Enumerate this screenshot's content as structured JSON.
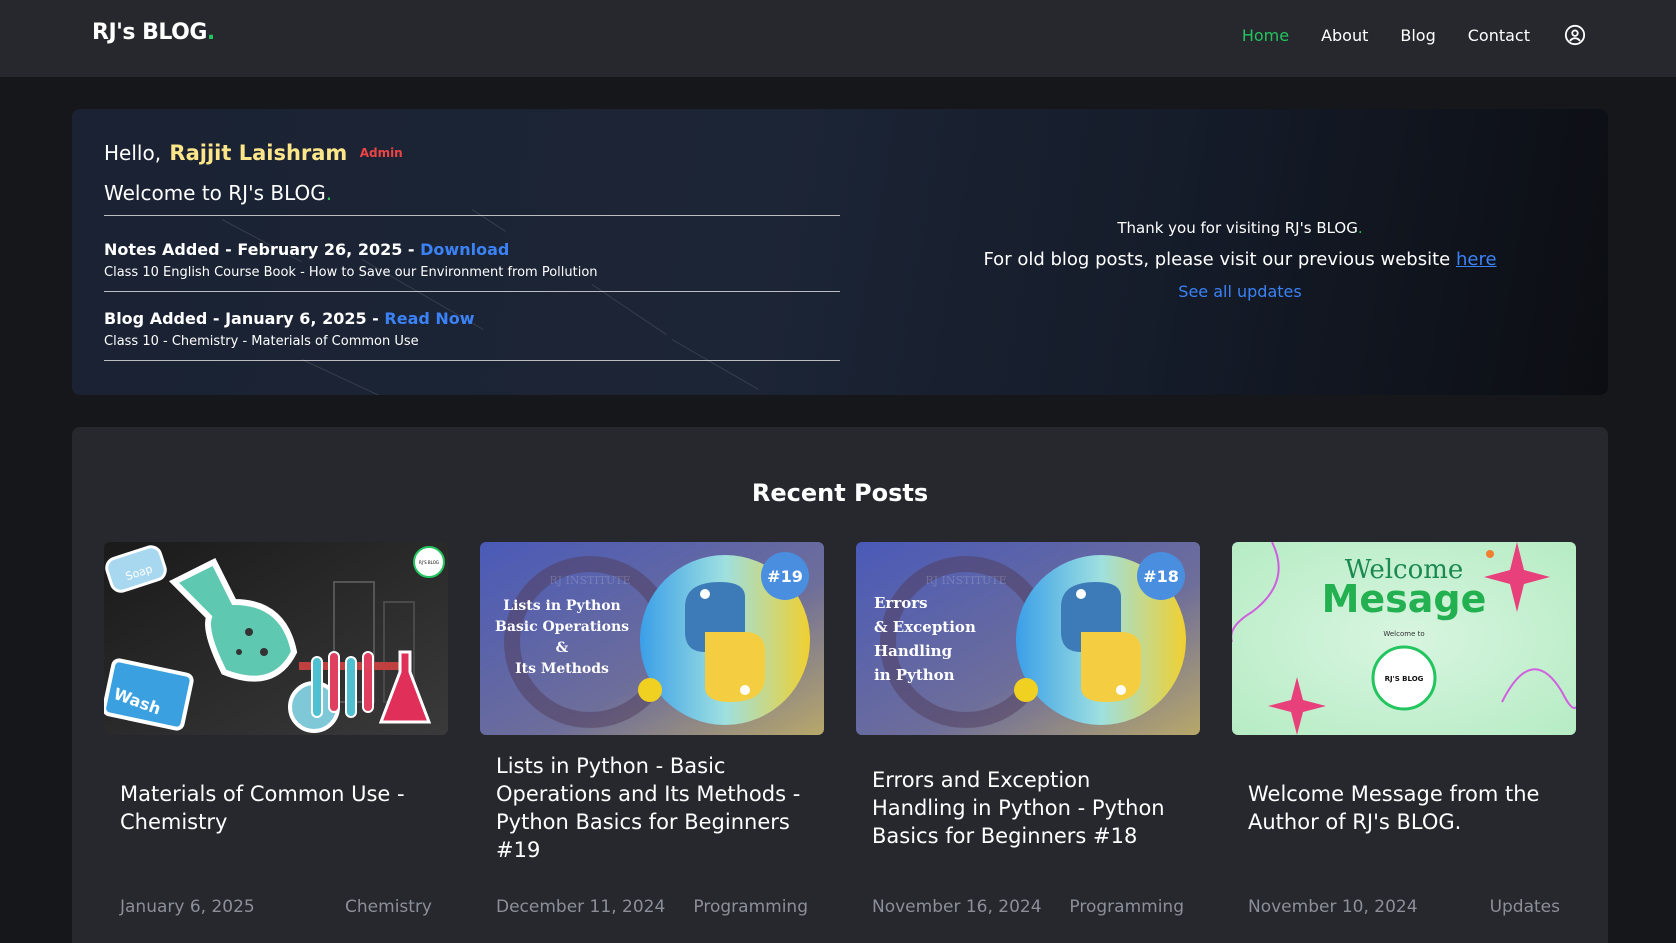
{
  "brand": {
    "name": "RJ's BLOG",
    "dot": "."
  },
  "nav": {
    "items": [
      {
        "label": "Home",
        "active": true
      },
      {
        "label": "About",
        "active": false
      },
      {
        "label": "Blog",
        "active": false
      },
      {
        "label": "Contact",
        "active": false
      }
    ],
    "user_icon": "user-circle-icon"
  },
  "hero": {
    "greeting": "Hello,",
    "name": "Rajjit Laishram",
    "role": "Admin",
    "welcome": "Welcome to RJ's BLOG",
    "welcome_dot": ".",
    "updates": [
      {
        "heading": "Notes Added - February 26, 2025 -",
        "link": "Download",
        "desc": "Class 10 English Course Book - How to Save our Environment from Pollution"
      },
      {
        "heading": "Blog Added - January 6, 2025 -",
        "link": "Read Now",
        "desc": "Class 10 - Chemistry - Materials of Common Use"
      }
    ],
    "thanks": "Thank you for visiting RJ's BLOG",
    "thanks_dot": ".",
    "old_posts": "For old blog posts, please visit our previous website",
    "old_link": "here",
    "see_all": "See all updates"
  },
  "recent": {
    "title": "Recent Posts",
    "posts": [
      {
        "title": "Materials of Common Use - Chemistry",
        "date": "January 6, 2025",
        "category": "Chemistry",
        "thumb": {
          "labels": [
            "Soap",
            "Wash",
            "RJ'S BLOG"
          ]
        }
      },
      {
        "title": "Lists in Python - Basic Operations and Its Methods - Python Basics for Beginners #19",
        "date": "December 11, 2024",
        "category": "Programming",
        "thumb": {
          "text": [
            "Lists in Python",
            "Basic Operations",
            "&",
            "Its Methods"
          ],
          "badge": "#19",
          "seal": "RJ INSTITUTE"
        }
      },
      {
        "title": "Errors and Exception Handling in Python - Python Basics for Beginners #18",
        "date": "November 16, 2024",
        "category": "Programming",
        "thumb": {
          "text": [
            "Errors",
            "& Exception",
            "Handling",
            "in Python"
          ],
          "badge": "#18",
          "seal": "RJ INSTITUTE"
        }
      },
      {
        "title": "Welcome Message from the Author of RJ's BLOG.",
        "date": "November 10, 2024",
        "category": "Updates",
        "thumb": {
          "script": "Welcome",
          "big": "Mesage",
          "small": "Welcome to",
          "logo": "RJ'S BLOG"
        }
      }
    ]
  },
  "colors": {
    "accent": "#22c55e",
    "link": "#3b82f6",
    "admin": "#ef4444",
    "name": "#fde68a"
  }
}
